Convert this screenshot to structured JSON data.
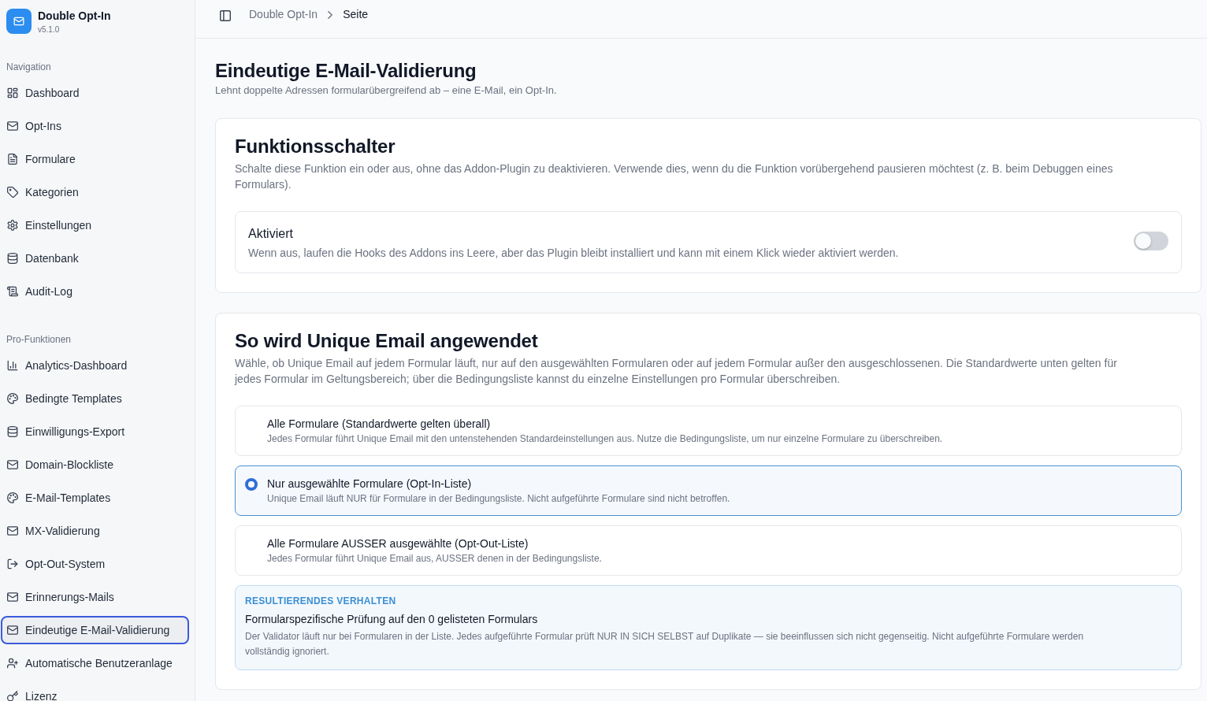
{
  "sidebar": {
    "app_name": "Double Opt-In",
    "version": "v5.1.0",
    "groups": [
      {
        "label": "Navigation",
        "items": [
          {
            "label": "Dashboard",
            "selected": false
          },
          {
            "label": "Opt-Ins",
            "selected": false
          },
          {
            "label": "Formulare",
            "selected": false
          },
          {
            "label": "Kategorien",
            "selected": false
          },
          {
            "label": "Einstellungen",
            "selected": false
          },
          {
            "label": "Datenbank",
            "selected": false
          },
          {
            "label": "Audit-Log",
            "selected": false
          }
        ]
      },
      {
        "label": "Pro-Funktionen",
        "items": [
          {
            "label": "Analytics-Dashboard",
            "selected": false
          },
          {
            "label": "Bedingte Templates",
            "selected": false
          },
          {
            "label": "Einwilligungs-Export",
            "selected": false
          },
          {
            "label": "Domain-Blockliste",
            "selected": false
          },
          {
            "label": "E-Mail-Templates",
            "selected": false
          },
          {
            "label": "MX-Validierung",
            "selected": false
          },
          {
            "label": "Opt-Out-System",
            "selected": false
          },
          {
            "label": "Erinnerungs-Mails",
            "selected": false
          },
          {
            "label": "Eindeutige E-Mail-Validierung",
            "selected": true
          },
          {
            "label": "Automatische Benutzeranlage",
            "selected": false
          },
          {
            "label": "Lizenz",
            "selected": false
          }
        ]
      }
    ]
  },
  "header": {
    "breadcrumb": [
      {
        "label": "Double Opt-In",
        "current": false
      },
      {
        "label": "Seite",
        "current": true
      }
    ]
  },
  "page": {
    "title": "Eindeutige E-Mail-Validierung",
    "subtitle": "Lehnt doppelte Adressen formularübergreifend ab – eine E-Mail, ein Opt-In."
  },
  "feature_switch": {
    "title": "Funktionsschalter",
    "description": "Schalte diese Funktion ein oder aus, ohne das Addon-Plugin zu deaktivieren. Verwende dies, wenn du die Funktion vorübergehend pausieren möchtest (z. B. beim Debuggen eines Formulars).",
    "setting": {
      "label": "Aktiviert",
      "description": "Wenn aus, laufen die Hooks des Addons ins Leere, aber das Plugin bleibt installiert und kann mit einem Klick wieder aktiviert werden.",
      "on": false
    }
  },
  "scope": {
    "title": "So wird Unique Email angewendet",
    "description": "Wähle, ob Unique Email auf jedem Formular läuft, nur auf den ausgewählten Formularen oder auf jedem Formular außer den ausgeschlossenen. Die Standardwerte unten gelten für jedes Formular im Geltungsbereich; über die Bedingungsliste kannst du einzelne Einstellungen pro Formular überschreiben.",
    "options": [
      {
        "title": "Alle Formulare (Standardwerte gelten überall)",
        "description": "Jedes Formular führt Unique Email mit den untenstehenden Standardeinstellungen aus. Nutze die Bedingungsliste, um nur einzelne Formulare zu überschreiben.",
        "selected": false
      },
      {
        "title": "Nur ausgewählte Formulare (Opt-In-Liste)",
        "description": "Unique Email läuft NUR für Formulare in der Bedingungsliste. Nicht aufgeführte Formulare sind nicht betroffen.",
        "selected": true
      },
      {
        "title": "Alle Formulare AUSSER ausgewählte (Opt-Out-Liste)",
        "description": "Jedes Formular führt Unique Email aus, AUSSER denen in der Bedingungsliste.",
        "selected": false
      }
    ],
    "result": {
      "label": "RESULTIERENDES VERHALTEN",
      "title": "Formularspezifische Prüfung auf den 0 gelisteten Formulars",
      "description": "Der Validator läuft nur bei Formularen in der Liste. Jedes aufgeführte Formular prüft NUR IN SICH SELBST auf Duplikate — sie beeinflussen sich nicht gegenseitig. Nicht aufgeführte Formulare werden vollständig ignoriert."
    }
  }
}
